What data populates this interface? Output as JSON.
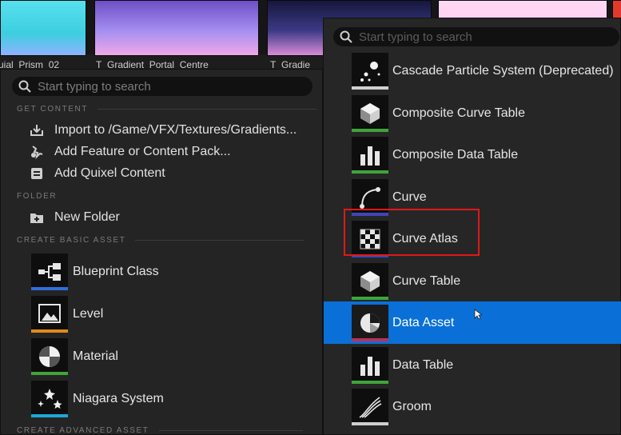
{
  "background": {
    "thumbnails": [
      {
        "label": "uial_Prism_02"
      },
      {
        "label": "T_Gradient_Portal_Centre"
      },
      {
        "label": "T_Gradie"
      }
    ]
  },
  "left_menu": {
    "search": {
      "placeholder": "Start typing to search"
    },
    "sections": {
      "get_content": "GET CONTENT",
      "folder": "FOLDER",
      "create_basic_asset": "CREATE BASIC ASSET",
      "create_advanced_asset": "CREATE ADVANCED ASSET"
    },
    "get_content_items": [
      {
        "label": "Import to /Game/VFX/Textures/Gradients...",
        "icon": "import-icon"
      },
      {
        "label": "Add Feature or Content Pack...",
        "icon": "feature-pack-icon"
      },
      {
        "label": "Add Quixel Content",
        "icon": "quixel-icon"
      }
    ],
    "folder_items": [
      {
        "label": "New Folder",
        "icon": "new-folder-icon"
      }
    ],
    "basic_assets": [
      {
        "label": "Blueprint Class",
        "icon": "blueprint-icon",
        "color": "#2f6fdc"
      },
      {
        "label": "Level",
        "icon": "level-icon",
        "color": "#e08a1c"
      },
      {
        "label": "Material",
        "icon": "material-icon",
        "color": "#3fa43a"
      },
      {
        "label": "Niagara System",
        "icon": "niagara-icon",
        "color": "#1ea6d6"
      }
    ]
  },
  "right_menu": {
    "search": {
      "placeholder": "Start typing to search"
    },
    "items": [
      {
        "label": "Cascade Particle System (Deprecated)",
        "icon": "particle-icon",
        "color": "#cfcfcf"
      },
      {
        "label": "Composite Curve Table",
        "icon": "composite-curve-table-icon",
        "color": "#3fa43a"
      },
      {
        "label": "Composite Data Table",
        "icon": "composite-data-table-icon",
        "color": "#3fa43a"
      },
      {
        "label": "Curve",
        "icon": "curve-icon",
        "color": "#3f46b8"
      },
      {
        "label": "Curve Atlas",
        "icon": "curve-atlas-icon",
        "color": "#3f46b8"
      },
      {
        "label": "Curve Table",
        "icon": "curve-table-icon",
        "color": "#3fa43a"
      },
      {
        "label": "Data Asset",
        "icon": "data-asset-icon",
        "color": "#b8315c"
      },
      {
        "label": "Data Table",
        "icon": "data-table-icon",
        "color": "#3fa43a"
      },
      {
        "label": "Groom",
        "icon": "groom-icon",
        "color": "#cfcfcf"
      }
    ],
    "selected_index": 6,
    "highlighted_index": 4
  },
  "colors": {
    "selection": "#0a70d8",
    "highlight_box": "#e01818"
  }
}
